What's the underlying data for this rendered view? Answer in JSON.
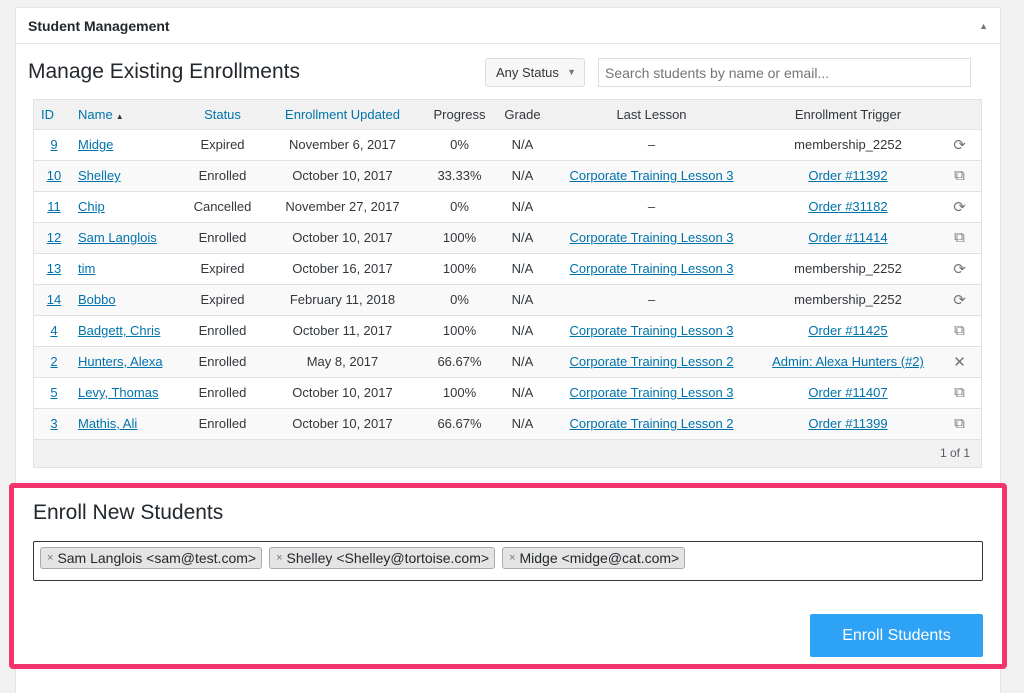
{
  "panel": {
    "title": "Student Management"
  },
  "manage": {
    "title": "Manage Existing Enrollments",
    "status_filter": "Any Status",
    "search_placeholder": "Search students by name or email..."
  },
  "table": {
    "headers": {
      "id": "ID",
      "name": "Name",
      "status": "Status",
      "updated": "Enrollment Updated",
      "progress": "Progress",
      "grade": "Grade",
      "last_lesson": "Last Lesson",
      "trigger": "Enrollment Trigger"
    },
    "rows": [
      {
        "id": "9",
        "name": "Midge",
        "status": "Expired",
        "updated": "November 6, 2017",
        "progress": "0%",
        "grade": "N/A",
        "last_lesson": "–",
        "trigger": "membership_2252",
        "trigger_link": false,
        "lesson_link": false,
        "icon": "sync-icon"
      },
      {
        "id": "10",
        "name": "Shelley",
        "status": "Enrolled",
        "updated": "October 10, 2017",
        "progress": "33.33%",
        "grade": "N/A",
        "last_lesson": "Corporate Training Lesson 3",
        "trigger": "Order #11392",
        "trigger_link": true,
        "lesson_link": true,
        "icon": "external-link-icon"
      },
      {
        "id": "11",
        "name": "Chip",
        "status": "Cancelled",
        "updated": "November 27, 2017",
        "progress": "0%",
        "grade": "N/A",
        "last_lesson": "–",
        "trigger": "Order #31182",
        "trigger_link": true,
        "lesson_link": false,
        "icon": "sync-icon"
      },
      {
        "id": "12",
        "name": "Sam Langlois",
        "status": "Enrolled",
        "updated": "October 10, 2017",
        "progress": "100%",
        "grade": "N/A",
        "last_lesson": "Corporate Training Lesson 3",
        "trigger": "Order #11414",
        "trigger_link": true,
        "lesson_link": true,
        "icon": "external-link-icon"
      },
      {
        "id": "13",
        "name": "tim",
        "status": "Expired",
        "updated": "October 16, 2017",
        "progress": "100%",
        "grade": "N/A",
        "last_lesson": "Corporate Training Lesson 3",
        "trigger": "membership_2252",
        "trigger_link": false,
        "lesson_link": true,
        "icon": "sync-icon"
      },
      {
        "id": "14",
        "name": "Bobbo",
        "status": "Expired",
        "updated": "February 11, 2018",
        "progress": "0%",
        "grade": "N/A",
        "last_lesson": "–",
        "trigger": "membership_2252",
        "trigger_link": false,
        "lesson_link": false,
        "icon": "sync-icon"
      },
      {
        "id": "4",
        "name": "Badgett, Chris",
        "status": "Enrolled",
        "updated": "October 11, 2017",
        "progress": "100%",
        "grade": "N/A",
        "last_lesson": "Corporate Training Lesson 3",
        "trigger": "Order #11425",
        "trigger_link": true,
        "lesson_link": true,
        "icon": "external-link-icon"
      },
      {
        "id": "2",
        "name": "Hunters, Alexa",
        "status": "Enrolled",
        "updated": "May 8, 2017",
        "progress": "66.67%",
        "grade": "N/A",
        "last_lesson": "Corporate Training Lesson 2",
        "trigger": "Admin: Alexa Hunters (#2)",
        "trigger_link": true,
        "lesson_link": true,
        "icon": "close-icon"
      },
      {
        "id": "5",
        "name": "Levy, Thomas",
        "status": "Enrolled",
        "updated": "October 10, 2017",
        "progress": "100%",
        "grade": "N/A",
        "last_lesson": "Corporate Training Lesson 3",
        "trigger": "Order #11407",
        "trigger_link": true,
        "lesson_link": true,
        "icon": "external-link-icon"
      },
      {
        "id": "3",
        "name": "Mathis, Ali",
        "status": "Enrolled",
        "updated": "October 10, 2017",
        "progress": "66.67%",
        "grade": "N/A",
        "last_lesson": "Corporate Training Lesson 2",
        "trigger": "Order #11399",
        "trigger_link": true,
        "lesson_link": true,
        "icon": "external-link-icon"
      }
    ],
    "pagination": "1 of 1"
  },
  "enroll": {
    "title": "Enroll New Students",
    "selected": [
      "Sam Langlois <sam@test.com>",
      "Shelley <Shelley@tortoise.com>",
      "Midge <midge@cat.com>"
    ],
    "button_label": "Enroll Students"
  },
  "colors": {
    "accent": "#2ea2f5",
    "highlight_border": "#f2346c",
    "link": "#0073aa"
  }
}
